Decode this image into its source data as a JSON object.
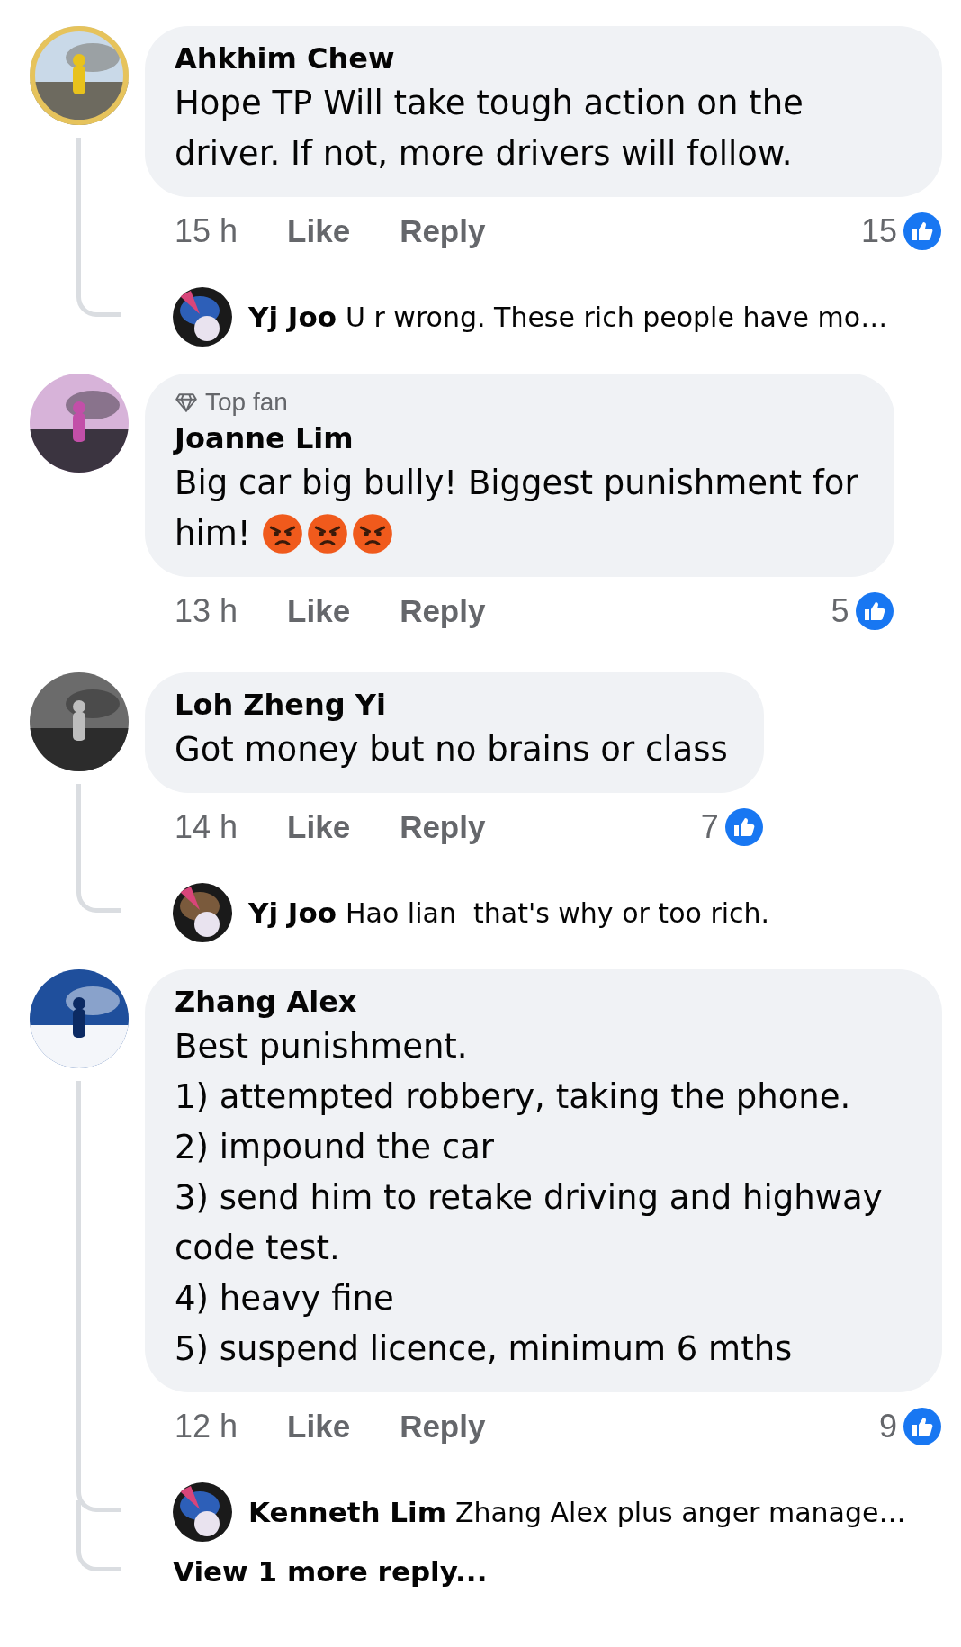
{
  "comments": [
    {
      "author": "Ahkhim Chew",
      "text": "Hope TP Will take tough action on the driver. If not, more drivers will follow.",
      "time": "15 h",
      "like": "Like",
      "reply": "Reply",
      "reactions": "15",
      "replies": [
        {
          "kind": "reply",
          "author": "Yj Joo",
          "text": "U r wrong. These rich people have mo…"
        }
      ]
    },
    {
      "badge": "Top fan",
      "author": "Joanne Lim",
      "text": "Big car big bully! Biggest punishment for",
      "tail": "him!",
      "emoji": [
        {
          "kind": "angry"
        },
        {
          "kind": "angry"
        },
        {
          "kind": "angry"
        }
      ],
      "time": "13 h",
      "like": "Like",
      "reply": "Reply",
      "reactions": "5"
    },
    {
      "author": "Loh Zheng Yi",
      "text": "Got money but no brains or class",
      "time": "14 h",
      "like": "Like",
      "reply": "Reply",
      "reactions": "7",
      "replies": [
        {
          "kind": "reply",
          "author": "Yj Joo",
          "text": "Hao lian  that's why or too rich."
        }
      ]
    },
    {
      "author": "Zhang Alex",
      "text": "Best punishment.\n1) attempted robbery, taking the phone.\n2) impound the car\n3) send him to retake driving and highway code test.\n4) heavy fine\n5) suspend licence, minimum 6 mths",
      "time": "12 h",
      "like": "Like",
      "reply": "Reply",
      "reactions": "9",
      "replies": [
        {
          "kind": "reply",
          "author": "Kenneth Lim",
          "text": "Zhang Alex plus anger manage…"
        },
        {
          "kind": "more",
          "text": "View 1 more reply..."
        }
      ]
    }
  ]
}
